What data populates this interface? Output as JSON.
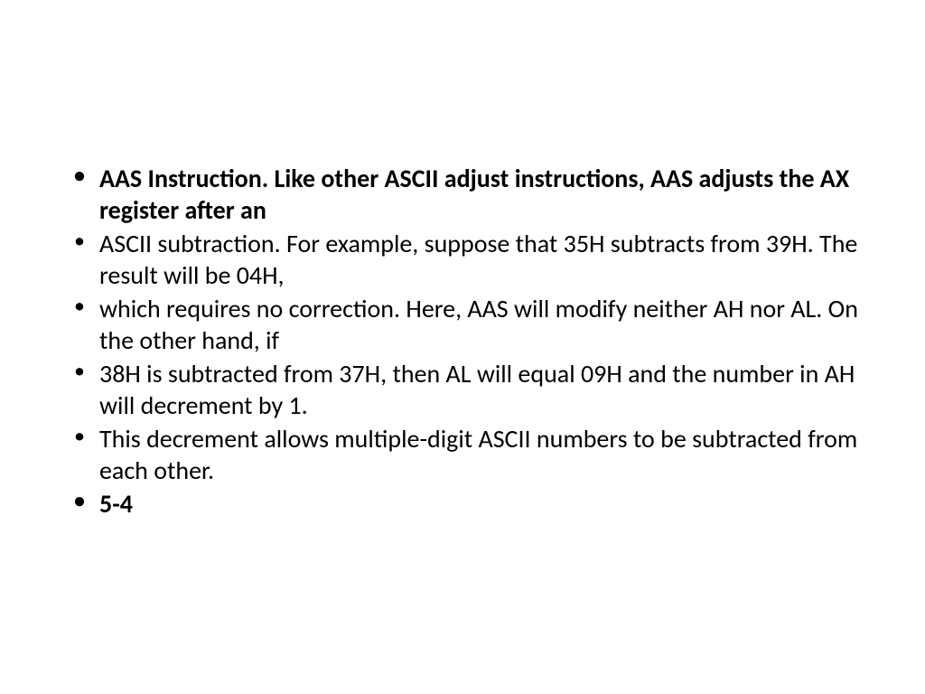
{
  "bullets": [
    {
      "text": "AAS Instruction. Like other ASCII adjust instructions, AAS adjusts the AX register after an",
      "bold": true
    },
    {
      "text": "ASCII subtraction. For example, suppose that 35H subtracts from 39H. The result will be 04H,",
      "bold": false
    },
    {
      "text": "which requires no correction. Here, AAS will modify neither AH nor AL. On the other hand, if",
      "bold": false
    },
    {
      "text": "38H is subtracted from 37H, then AL will equal 09H and the number in AH will decrement by 1.",
      "bold": false
    },
    {
      "text": "This decrement allows multiple-digit ASCII numbers to be subtracted from each other.",
      "bold": false
    },
    {
      "text": "5-4",
      "bold": true
    }
  ]
}
